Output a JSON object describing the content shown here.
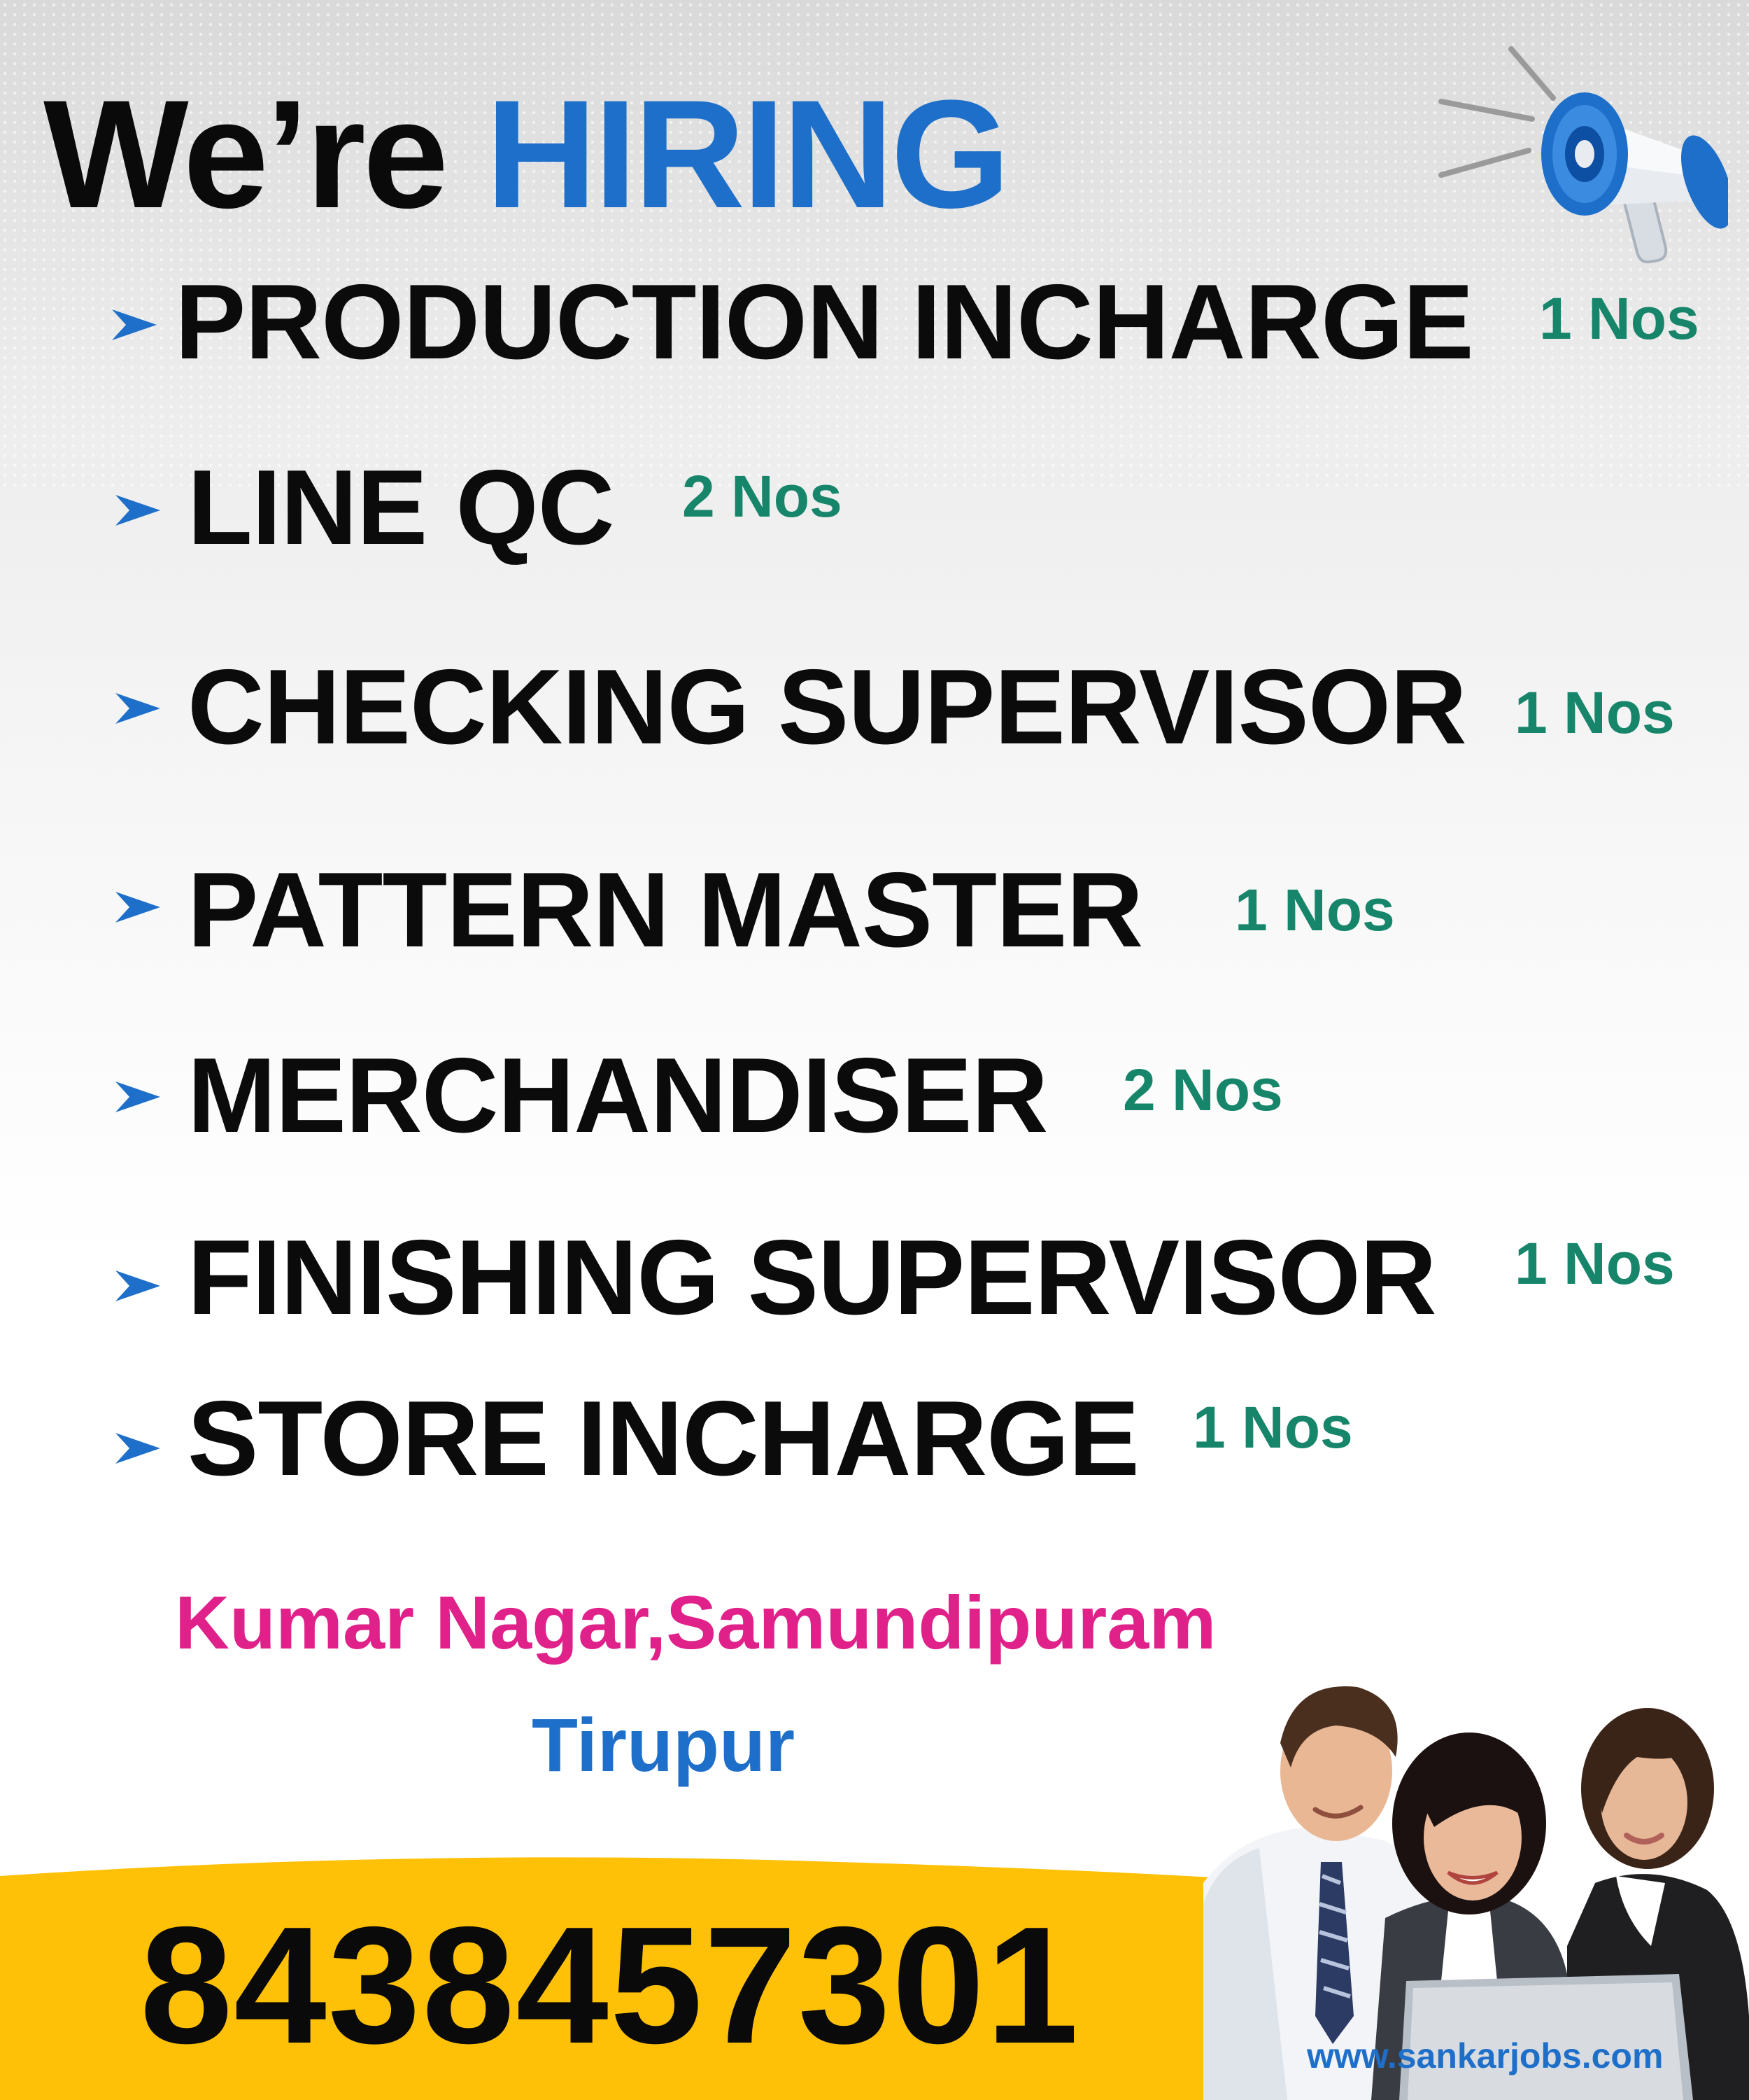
{
  "headline": {
    "part1": "We’re",
    "part2": "HIRING"
  },
  "icons": {
    "announcement": "megaphone-icon",
    "bullet": "chevron-arrow-icon",
    "photo": "team-photo"
  },
  "jobs": [
    {
      "title": "PRODUCTION INCHARGE",
      "count": "1 Nos"
    },
    {
      "title": "LINE QC",
      "count": "2 Nos"
    },
    {
      "title": "CHECKING SUPERVISOR",
      "count": "1 Nos"
    },
    {
      "title": "PATTERN MASTER",
      "count": "1 Nos"
    },
    {
      "title": "MERCHANDISER",
      "count": "2 Nos"
    },
    {
      "title": "FINISHING SUPERVISOR",
      "count": "1 Nos"
    },
    {
      "title": "STORE INCHARGE",
      "count": "1 Nos"
    }
  ],
  "location": {
    "line1": "Kumar Nagar,Samundipuram",
    "line2": "Tirupur"
  },
  "contact": {
    "phone": "8438457301",
    "website": "www.sankarjobs.com"
  },
  "colors": {
    "headline_accent": "#1e6fc9",
    "count_green": "#16856a",
    "location_pink": "#e0218a",
    "band_yellow": "#ffc107",
    "text_black": "#0a0a0a"
  }
}
